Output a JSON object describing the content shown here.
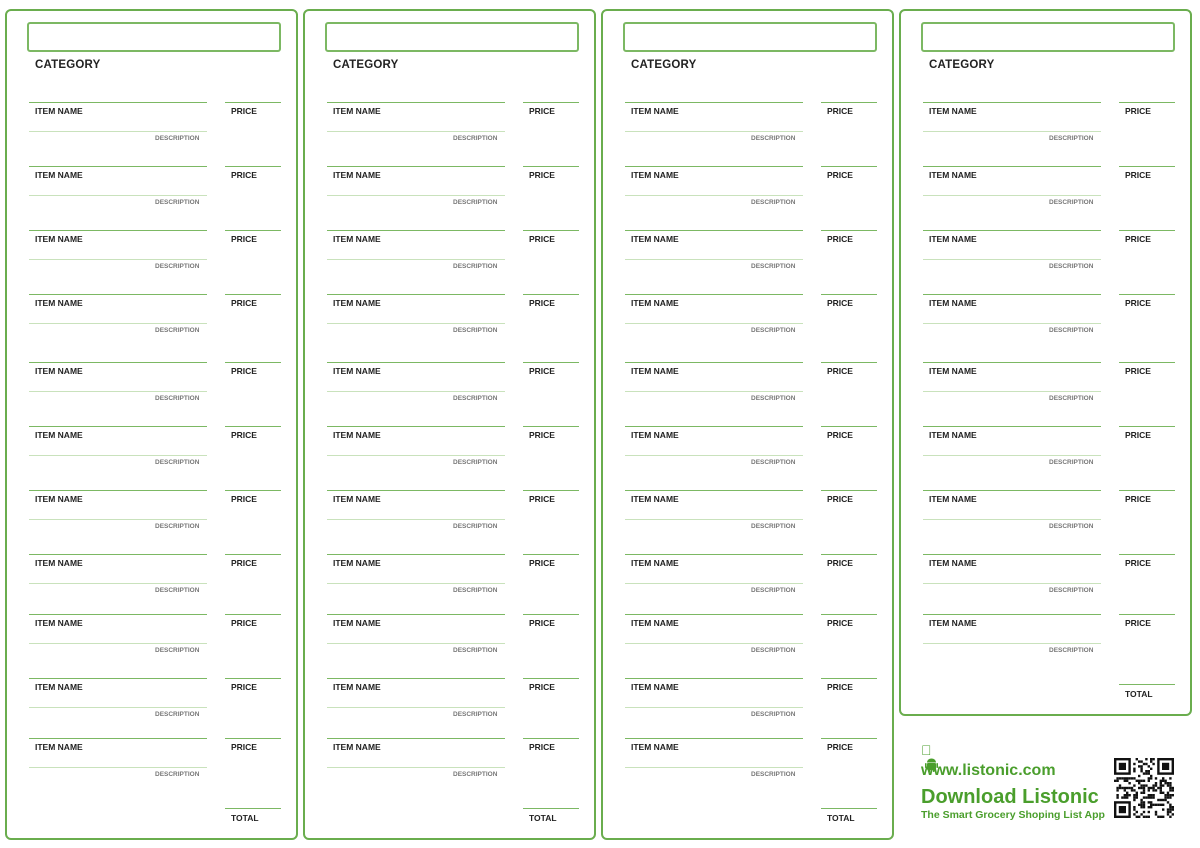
{
  "sheet": {
    "category_label": "CATEGORY",
    "item_label": "ITEM NAME",
    "price_label": "PRICE",
    "description_label": "DESCRIPTION",
    "total_label": "TOTAL"
  },
  "columns": [
    {
      "category_value": "",
      "item_count": 11
    },
    {
      "category_value": "",
      "item_count": 11
    },
    {
      "category_value": "",
      "item_count": 11
    },
    {
      "category_value": "",
      "item_count": 9
    }
  ],
  "promo": {
    "platform_icons": [
      "apple-icon",
      "android-icon"
    ],
    "website": "www.listonic.com",
    "headline": "Download Listonic",
    "tagline": "The Smart Grocery Shoping List App",
    "brand_color": "#4a9e2c"
  }
}
